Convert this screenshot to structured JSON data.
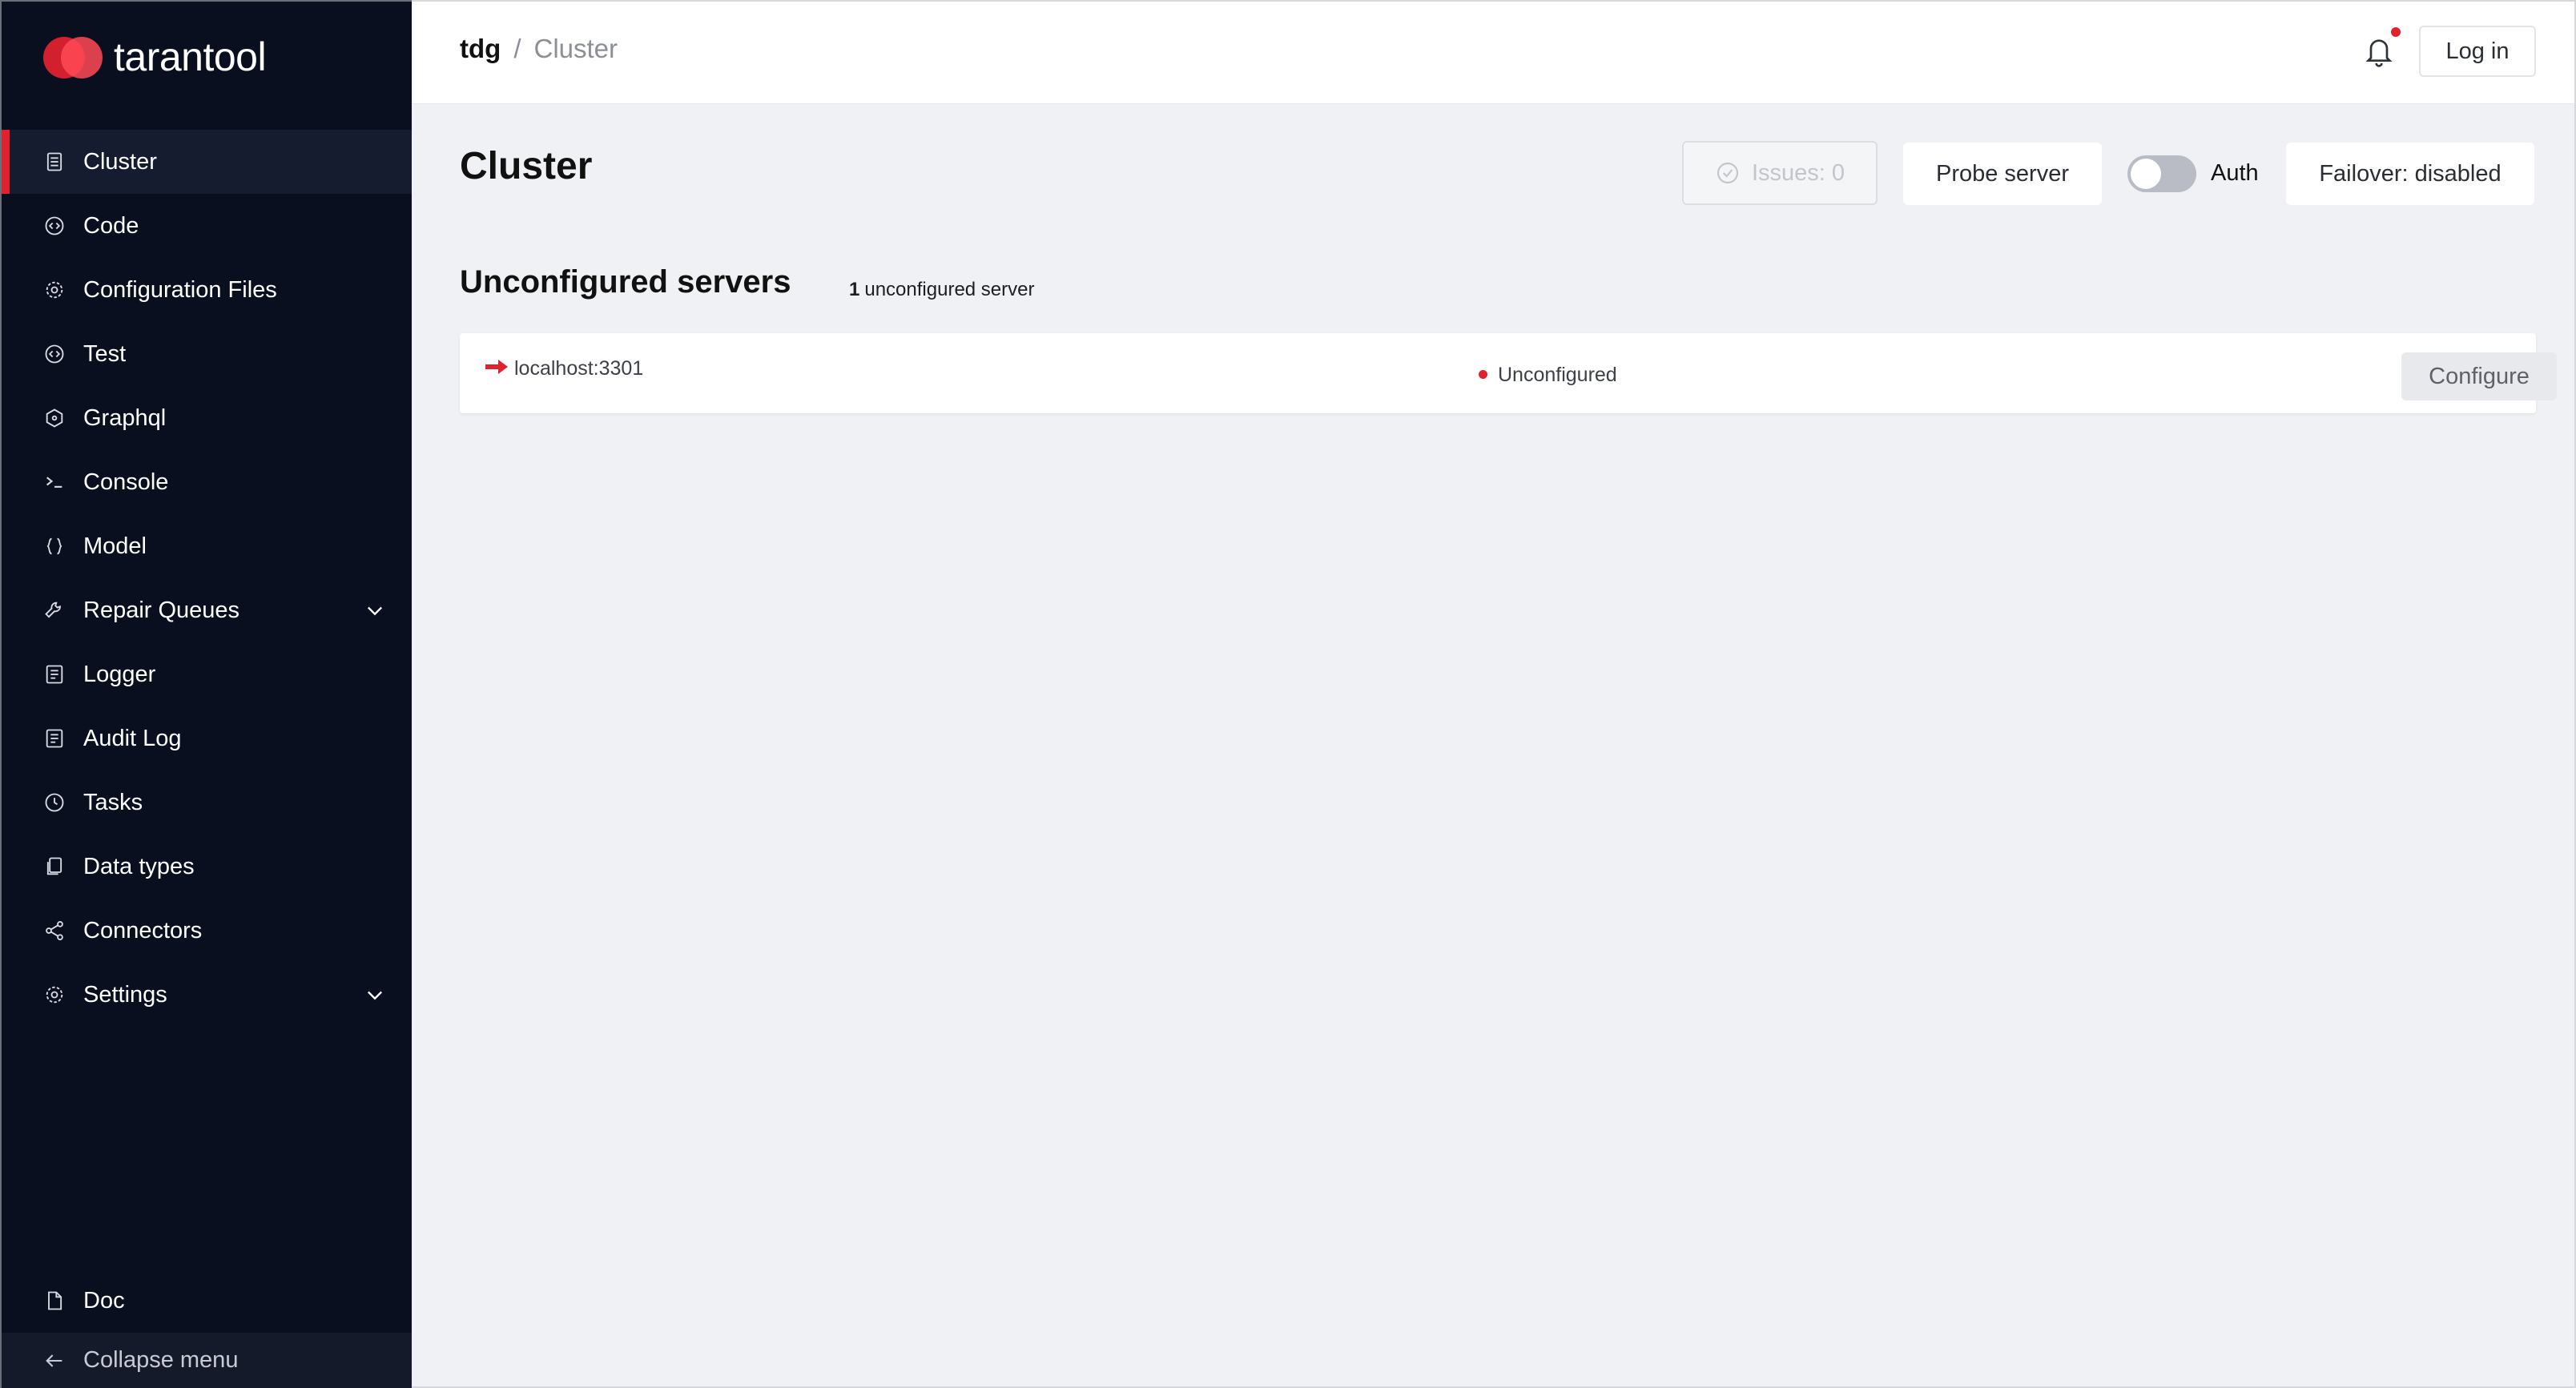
{
  "brand": {
    "name": "tarantool",
    "accent_color": "#e0212e",
    "sidebar_bg": "#0a0f20"
  },
  "sidebar": {
    "items": [
      {
        "label": "Cluster",
        "icon": "server-icon",
        "active": true
      },
      {
        "label": "Code",
        "icon": "code-icon"
      },
      {
        "label": "Configuration Files",
        "icon": "gear-icon"
      },
      {
        "label": "Test",
        "icon": "code-icon"
      },
      {
        "label": "Graphql",
        "icon": "graphql-icon"
      },
      {
        "label": "Console",
        "icon": "terminal-icon"
      },
      {
        "label": "Model",
        "icon": "braces-icon"
      },
      {
        "label": "Repair Queues",
        "icon": "wrench-icon",
        "expandable": true
      },
      {
        "label": "Logger",
        "icon": "log-icon"
      },
      {
        "label": "Audit Log",
        "icon": "log-icon"
      },
      {
        "label": "Tasks",
        "icon": "clock-icon"
      },
      {
        "label": "Data types",
        "icon": "files-icon"
      },
      {
        "label": "Connectors",
        "icon": "share-icon"
      },
      {
        "label": "Settings",
        "icon": "gear-icon",
        "expandable": true
      }
    ],
    "doc_label": "Doc",
    "collapse_label": "Collapse menu"
  },
  "header": {
    "breadcrumb_root": "tdg",
    "breadcrumb_sep": "/",
    "breadcrumb_current": "Cluster",
    "login_label": "Log in",
    "has_notification": true
  },
  "main": {
    "title": "Cluster",
    "issues_label": "Issues: 0",
    "probe_label": "Probe server",
    "auth_label": "Auth",
    "auth_enabled": false,
    "failover_label": "Failover: disabled",
    "section_title": "Unconfigured servers",
    "section_count": "1",
    "section_count_label": "unconfigured server",
    "servers": [
      {
        "address": "localhost:3301",
        "status": "Unconfigured",
        "status_color": "#e0212e",
        "action": "Configure"
      }
    ]
  }
}
